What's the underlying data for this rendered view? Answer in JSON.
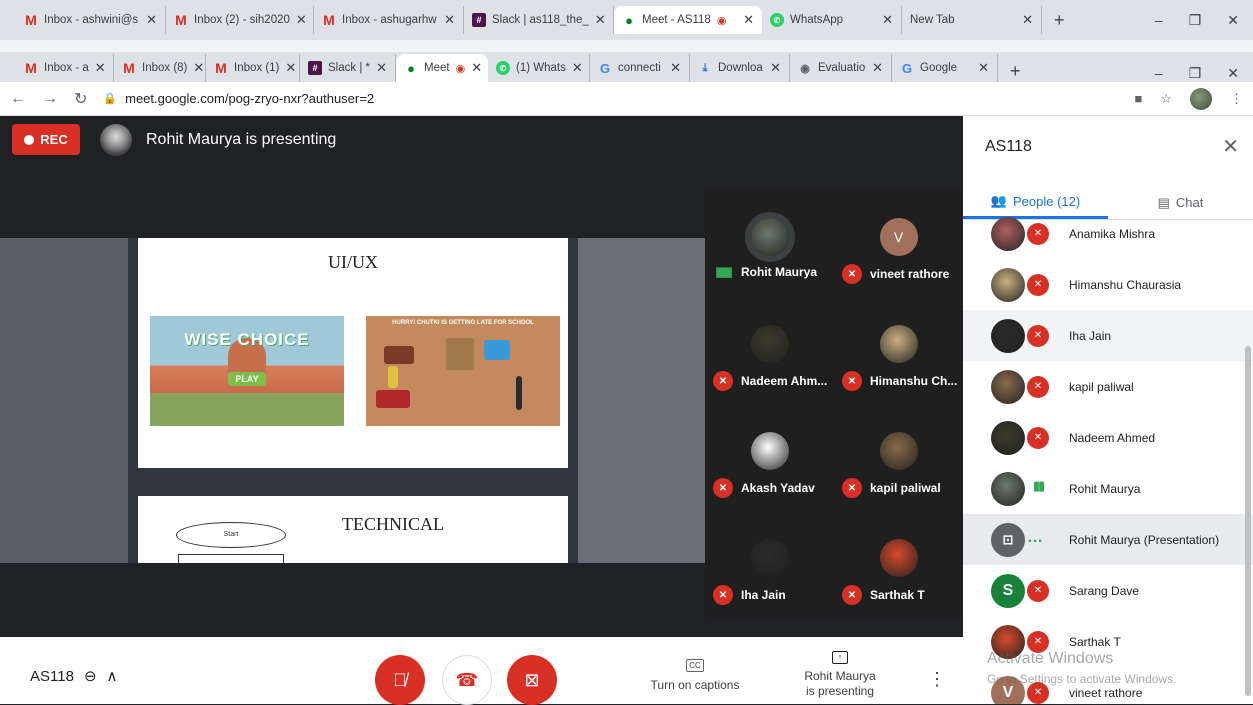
{
  "browser_outer": {
    "tabs": [
      {
        "icon": "gmail-icon",
        "label": "Inbox - ashwini@s"
      },
      {
        "icon": "gmail-icon",
        "label": "Inbox (2) - sih2020"
      },
      {
        "icon": "gmail-icon",
        "label": "Inbox - ashugarhw"
      },
      {
        "icon": "slack-icon",
        "label": "Slack | as118_the_"
      },
      {
        "icon": "meet-icon",
        "label": "Meet - AS118"
      },
      {
        "icon": "whatsapp-icon",
        "label": "WhatsApp"
      },
      {
        "icon": "none",
        "label": "New Tab"
      }
    ]
  },
  "browser_inner": {
    "tabs": [
      {
        "icon": "gmail-icon",
        "label": "Inbox - a"
      },
      {
        "icon": "gmail-icon",
        "label": "Inbox (8)"
      },
      {
        "icon": "gmail-icon",
        "label": "Inbox (1)"
      },
      {
        "icon": "slack-icon",
        "label": "Slack | *"
      },
      {
        "icon": "meet-icon",
        "label": "Meet"
      },
      {
        "icon": "whatsapp-icon",
        "label": "(1) Whats"
      },
      {
        "icon": "google-icon",
        "label": "connecti"
      },
      {
        "icon": "download-icon",
        "label": "Downloa"
      },
      {
        "icon": "globe-icon",
        "label": "Evaluatio"
      },
      {
        "icon": "google-icon",
        "label": "Google"
      }
    ],
    "url": "meet.google.com/pog-zryo-nxr?authuser=2"
  },
  "meeting": {
    "rec_label": "REC",
    "presenter_text": "Rohit Maurya is presenting",
    "code": "AS118",
    "captions_label": "Turn on captions",
    "presenting_label_1": "Rohit Maurya",
    "presenting_label_2": "is presenting"
  },
  "slides": {
    "slide1_title": "UI/UX",
    "img1_text": "WISE CHOICE",
    "img1_play": "PLAY",
    "img2_text": "HURRY! CHUTKI IS GETTING LATE FOR SCHOOL",
    "slide2_title": "TECHNICAL",
    "flow_start": "Start"
  },
  "tiles": [
    {
      "name": "Rohit Maurya",
      "speaking": true,
      "avatar": "photo",
      "color": "#6b7a6b"
    },
    {
      "name": "vineet rathore",
      "speaking": false,
      "avatar": "V",
      "color": "#a0705a"
    },
    {
      "name": "Nadeem Ahm...",
      "speaking": false,
      "avatar": "photo",
      "color": "#3a3a2a"
    },
    {
      "name": "Himanshu Ch...",
      "speaking": false,
      "avatar": "photo",
      "color": "#c9b080"
    },
    {
      "name": "Akash Yadav",
      "speaking": false,
      "avatar": "photo",
      "color": "#ffffff"
    },
    {
      "name": "kapil paliwal",
      "speaking": false,
      "avatar": "photo",
      "color": "#8a6a4a"
    },
    {
      "name": "Iha Jain",
      "speaking": false,
      "avatar": "photo",
      "color": "#2a2a2a"
    },
    {
      "name": "Sarthak T",
      "speaking": false,
      "avatar": "photo",
      "color": "#d94a2a"
    }
  ],
  "panel": {
    "title": "AS118",
    "people_tab": "People (12)",
    "chat_tab": "Chat",
    "people": [
      {
        "name": "Anamika Mishra",
        "avatar": "photo",
        "color": "#b06060",
        "mic": "off"
      },
      {
        "name": "Himanshu Chaurasia",
        "avatar": "photo",
        "color": "#c9b080",
        "mic": "off"
      },
      {
        "name": "Iha Jain",
        "avatar": "photo",
        "color": "#2a2a2a",
        "mic": "off"
      },
      {
        "name": "kapil paliwal",
        "avatar": "photo",
        "color": "#8a6a4a",
        "mic": "off"
      },
      {
        "name": "Nadeem Ahmed",
        "avatar": "photo",
        "color": "#3a3a2a",
        "mic": "off"
      },
      {
        "name": "Rohit Maurya",
        "avatar": "photo",
        "color": "#6b7a6b",
        "mic": "speaking"
      },
      {
        "name": "Rohit Maurya (Presentation)",
        "avatar": "present",
        "color": "#5f6368",
        "mic": "dots"
      },
      {
        "name": "Sarang Dave",
        "avatar": "S",
        "color": "#188038",
        "mic": "off"
      },
      {
        "name": "Sarthak T",
        "avatar": "photo",
        "color": "#d94a2a",
        "mic": "off"
      },
      {
        "name": "vineet rathore",
        "avatar": "V",
        "color": "#a0705a",
        "mic": "off"
      }
    ],
    "watermark_1": "Activate Windows",
    "watermark_2": "Go to Settings to activate Windows."
  },
  "colors": {
    "accent": "#1a73e8",
    "danger": "#d93025",
    "speaking": "#34a853"
  }
}
